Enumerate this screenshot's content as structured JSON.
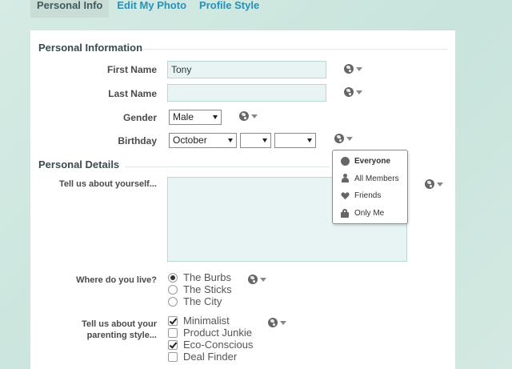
{
  "tabs": [
    {
      "label": "Personal Info"
    },
    {
      "label": "Edit My Photo"
    },
    {
      "label": "Profile Style"
    }
  ],
  "personal_information": {
    "title": "Personal Information",
    "first_name": {
      "label": "First Name",
      "value": "Tony"
    },
    "last_name": {
      "label": "Last Name",
      "value": ""
    },
    "gender": {
      "label": "Gender",
      "value": "Male"
    },
    "birthday": {
      "label": "Birthday",
      "month": "October",
      "day": "",
      "year": ""
    }
  },
  "privacy_menu": {
    "items": [
      {
        "label": "Everyone",
        "icon": "globe-icon",
        "selected": true
      },
      {
        "label": "All Members",
        "icon": "person-icon"
      },
      {
        "label": "Friends",
        "icon": "heart-icon"
      },
      {
        "label": "Only Me",
        "icon": "lock-icon"
      }
    ]
  },
  "personal_details": {
    "title": "Personal Details",
    "about": {
      "label": "Tell us about yourself...",
      "value": ""
    },
    "live": {
      "label": "Where do you live?",
      "options": [
        {
          "label": "The Burbs",
          "checked": true
        },
        {
          "label": "The Sticks",
          "checked": false
        },
        {
          "label": "The City",
          "checked": false
        }
      ]
    },
    "parenting": {
      "label_line1": "Tell us about your",
      "label_line2": "parenting style...",
      "options": [
        {
          "label": "Minimalist",
          "checked": true
        },
        {
          "label": "Product Junkie",
          "checked": false
        },
        {
          "label": "Eco-Conscious",
          "checked": true
        },
        {
          "label": "Deal Finder",
          "checked": false
        }
      ]
    }
  },
  "colors": {
    "tab_link": "#2a8fb5",
    "active_tab_bg": "#c9dcd6",
    "input_bg": "#e8f4f4",
    "page_bg": "#d5ebe4"
  }
}
